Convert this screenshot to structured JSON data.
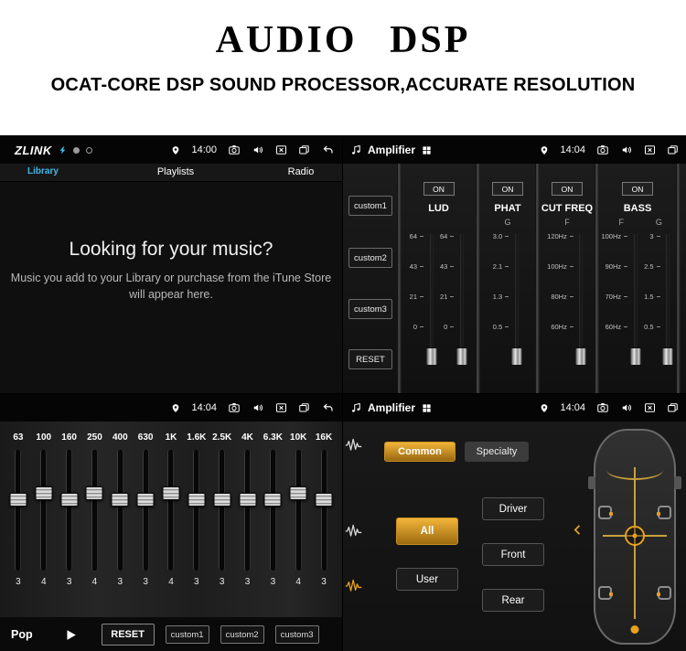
{
  "header": {
    "title": "AUDIO DSP",
    "subtitle": "OCAT-CORE DSP SOUND PROCESSOR,ACCURATE RESOLUTION"
  },
  "colors": {
    "accent": "#E8A21C",
    "library_blue": "#45B6E8"
  },
  "icons": {
    "pin": "location-pin",
    "camera": "camera",
    "speaker": "volume-speaker",
    "xbox": "close-x-box",
    "windows": "recent-apps-windows",
    "back": "return-arrow",
    "grid": "app-grid",
    "note": "music-note",
    "spark": "zlink-spark",
    "wave": "audio-waveform",
    "chevron": "chevron-left",
    "play": "play-triangle"
  },
  "music": {
    "logo": "ZLINK",
    "library_label": "Library",
    "time": "14:00",
    "tabs": [
      {
        "label": "Playlists"
      },
      {
        "label": "Radio"
      }
    ],
    "heading": "Looking for your music?",
    "body": "Music you add to your Library or purchase from the iTune Store will appear here."
  },
  "dsp": {
    "title": "Amplifier",
    "time": "14:04",
    "on_label": "ON",
    "side_buttons": [
      {
        "label": "custom1"
      },
      {
        "label": "custom2"
      },
      {
        "label": "custom3"
      },
      {
        "label": "RESET"
      }
    ],
    "channels": [
      {
        "name": "LUD",
        "sliders": [
          {
            "letter": "",
            "ticks": [
              "64",
              "43",
              "21",
              "0"
            ]
          },
          {
            "letter": "",
            "ticks": [
              "64",
              "43",
              "21",
              "0"
            ]
          }
        ]
      },
      {
        "name": "PHAT",
        "sliders": [
          {
            "letter": "G",
            "ticks": [
              "3.0",
              "2.1",
              "1.3",
              "0.5"
            ]
          }
        ]
      },
      {
        "name": "CUT FREQ",
        "sliders": [
          {
            "letter": "F",
            "ticks": [
              "120Hz",
              "100Hz",
              "80Hz",
              "60Hz"
            ]
          }
        ]
      },
      {
        "name": "BASS",
        "sliders": [
          {
            "letter": "F",
            "ticks": [
              "100Hz",
              "90Hz",
              "70Hz",
              "60Hz"
            ]
          },
          {
            "letter": "G",
            "ticks": [
              "3",
              "2.5",
              "1.5",
              "0.5"
            ]
          }
        ]
      }
    ]
  },
  "eq": {
    "time": "14:04",
    "preset": "Pop",
    "reset_label": "RESET",
    "custom_buttons": [
      {
        "label": "custom1"
      },
      {
        "label": "custom2"
      },
      {
        "label": "custom3"
      }
    ],
    "bands": [
      {
        "freq": "63",
        "value": "3"
      },
      {
        "freq": "100",
        "value": "4"
      },
      {
        "freq": "160",
        "value": "3"
      },
      {
        "freq": "250",
        "value": "4"
      },
      {
        "freq": "400",
        "value": "3"
      },
      {
        "freq": "630",
        "value": "3"
      },
      {
        "freq": "1K",
        "value": "4"
      },
      {
        "freq": "1.6K",
        "value": "3"
      },
      {
        "freq": "2.5K",
        "value": "3"
      },
      {
        "freq": "4K",
        "value": "3"
      },
      {
        "freq": "6.3K",
        "value": "3"
      },
      {
        "freq": "10K",
        "value": "4"
      },
      {
        "freq": "16K",
        "value": "3"
      }
    ]
  },
  "speaker": {
    "title": "Amplifier",
    "time": "14:04",
    "tabs": [
      {
        "label": "Common",
        "active": true
      },
      {
        "label": "Specialty",
        "active": false
      }
    ],
    "left_buttons": [
      {
        "label": "All",
        "active": true
      },
      {
        "label": "User",
        "active": false
      }
    ],
    "right_buttons": [
      {
        "label": "Driver"
      },
      {
        "label": "Front"
      },
      {
        "label": "Rear"
      }
    ]
  }
}
